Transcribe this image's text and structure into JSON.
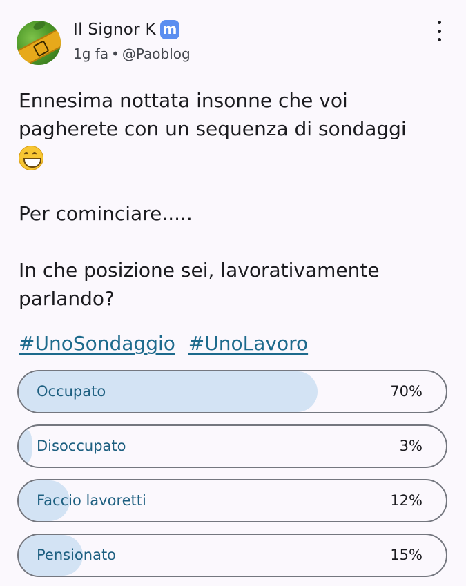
{
  "post": {
    "author_name": "Il Signor K",
    "time_ago": "1g fa",
    "handle": "@Paoblog",
    "text_line1": "Ennesima nottata insonne che voi",
    "text_line2": "pagherete con un sequenza di sondaggi",
    "text_p2": "Per cominciare.....",
    "text_p3_line1": "In che posizione sei, lavorativamente",
    "text_p3_line2": "parlando?",
    "hashtags": [
      "#UnoSondaggio",
      "#UnoLavoro"
    ]
  },
  "icons": {
    "badge": "mastodon-icon",
    "menu": "more-vert-icon",
    "emoji": "grinning-face-emoji"
  },
  "poll": {
    "options": [
      {
        "label": "Occupato",
        "percent": "70%",
        "value": 70
      },
      {
        "label": "Disoccupato",
        "percent": "3%",
        "value": 3
      },
      {
        "label": "Faccio lavoretti",
        "percent": "12%",
        "value": 12
      },
      {
        "label": "Pensionato",
        "percent": "15%",
        "value": 15
      }
    ]
  },
  "colors": {
    "accent": "#1d6a8c",
    "poll_fill": "#d3e3f4",
    "badge": "#5b8ef0"
  }
}
